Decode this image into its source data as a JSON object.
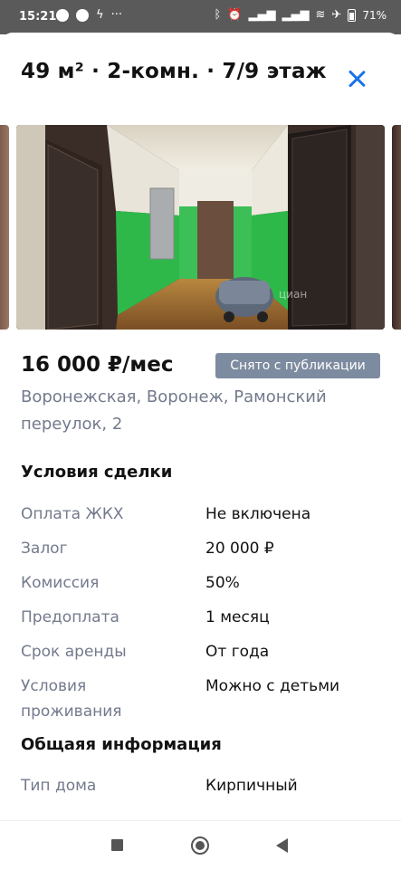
{
  "status_bar": {
    "time": "15:21",
    "left_icons": [
      "app-icon",
      "app-icon",
      "flash-icon",
      "more-icon"
    ],
    "right_icons": [
      "bluetooth-icon",
      "alarm-icon",
      "signal-icon",
      "signal-icon",
      "wifi-icon",
      "airplane-mode-icon"
    ],
    "battery": "71",
    "battery_suffix": "%"
  },
  "listing": {
    "title": "49 м² · 2-комн. · 7/9 этаж",
    "price": "16 000 ₽/мес",
    "status_badge": "Снято с публикации",
    "address": "Воронежская, Воронеж, Рамонский переулок, 2",
    "photo_watermark": "циан"
  },
  "deal_terms": {
    "heading": "Условия сделки",
    "rows": [
      {
        "label": "Оплата ЖКХ",
        "value": "Не включена"
      },
      {
        "label": "Залог",
        "value": "20 000 ₽"
      },
      {
        "label": "Комиссия",
        "value": "50%"
      },
      {
        "label": "Предоплата",
        "value": "1 месяц"
      },
      {
        "label": "Срок аренды",
        "value": "От года"
      },
      {
        "label": "Условия проживания",
        "value": "Можно с детьми"
      }
    ]
  },
  "general_info": {
    "heading": "Общаяя информация",
    "rows": [
      {
        "label": "Тип дома",
        "value": "Кирпичный"
      }
    ]
  },
  "colors": {
    "accent": "#1a73e8",
    "badge_bg": "#7d8ba0",
    "muted_text": "#737a8c",
    "status_bar_bg": "#5a5a5a"
  },
  "nav_bar": {
    "buttons": [
      "recents-square-icon",
      "home-circle-icon",
      "back-triangle-icon"
    ]
  }
}
